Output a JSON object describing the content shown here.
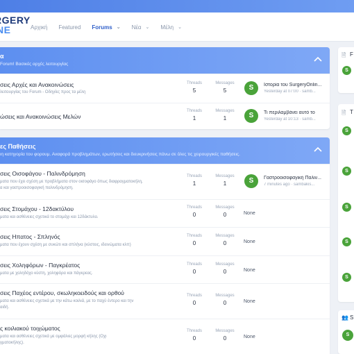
{
  "brand": {
    "line1": "RGERY",
    "line2": "NE"
  },
  "nav": {
    "home": "Αρχική",
    "featured": "Featured",
    "forums": "Forums",
    "news": "Νέα",
    "members": "Μέλη"
  },
  "labels": {
    "threads": "Threads",
    "messages": "Messages",
    "none": "None"
  },
  "categories": [
    {
      "title": "α",
      "desc": "Forum! Βασικές αρχές λειτουργίας",
      "forums": [
        {
          "title": "σεις Αρχές και Ανακοινώσεις",
          "desc": "λειτουργίας του Forum - Οδηγίες προς τα μέλη",
          "threads": "5",
          "messages": "5",
          "last_title": "Ιστορία του SurgeryOnlin...",
          "last_meta": "Yesterday at 07:00 · samb..."
        },
        {
          "title": "ώσεις και Ανακοινώσεις Μελών",
          "desc": "",
          "threads": "1",
          "messages": "1",
          "last_title": "Τι περιλαμβάνει αυτό το",
          "last_meta": "Yesterday at 10:13 · samb..."
        }
      ]
    },
    {
      "title": "ες Παθήσεις",
      "desc": "ιη κατηγορία του φορουμ. Αναφορά προβλημάτων, ερωτήσεις και διευκρινήσεις πάνω σε όλες τις χειρουργικές παθήσεις.",
      "forums": [
        {
          "title": "σεις Οισοφάγου - Παλινδρόμηση",
          "desc1": "ματα που έχει σχέση με προβλήματα στον οισοφάγο όπως διαφραγματοκήλη,",
          "desc2": "α και γαστροοισοφαγική παλινδρόμηση.",
          "threads": "1",
          "messages": "1",
          "last_title": "Γαστροοισοφαγική Παλιν...",
          "last_meta": "7 minutes ago · sambakis..."
        },
        {
          "title": "σεις Στομάχου - 12δακτύλου",
          "desc1": "ματα και ασθένειες σχετικά το στομάχι και 12δάκτυλο.",
          "desc2": "",
          "threads": "0",
          "messages": "0"
        },
        {
          "title": "σεις Ηπατος - Σπληνός",
          "desc1": "ματα που έχουν σχέση με συκώτι και σπλήνα (κύστεις, ιδεινώματα κλπ)",
          "desc2": "",
          "threads": "0",
          "messages": "0"
        },
        {
          "title": "σεις Χοληφόρων - Παγκρέατος",
          "desc1": "ματα με χοληδόχο κύστη, χοληφόρα και πάγκρεας.",
          "desc2": "",
          "threads": "0",
          "messages": "0"
        },
        {
          "title": "σεις Παχέος εντέρου, σκωληκοειδούς και ορθού",
          "desc1": "ματα και ασθένειες σχετικά με την κάτω κοιλιά, με το παχύ έντερο και την",
          "desc2": "αιδή.",
          "threads": "0",
          "messages": "0"
        },
        {
          "title": "ς κοιλιακού τοιχώματος",
          "desc1": "ματα και ασθένειες σχετικά με ομφάλιες μορφή κήλης (Οχι",
          "desc2": "γματοκήλης).",
          "threads": "0",
          "messages": "0"
        }
      ]
    }
  ],
  "sidebar": {
    "w1_title": "F",
    "w2_title": "T",
    "w3_title": "S",
    "avatar_letter": "S"
  }
}
